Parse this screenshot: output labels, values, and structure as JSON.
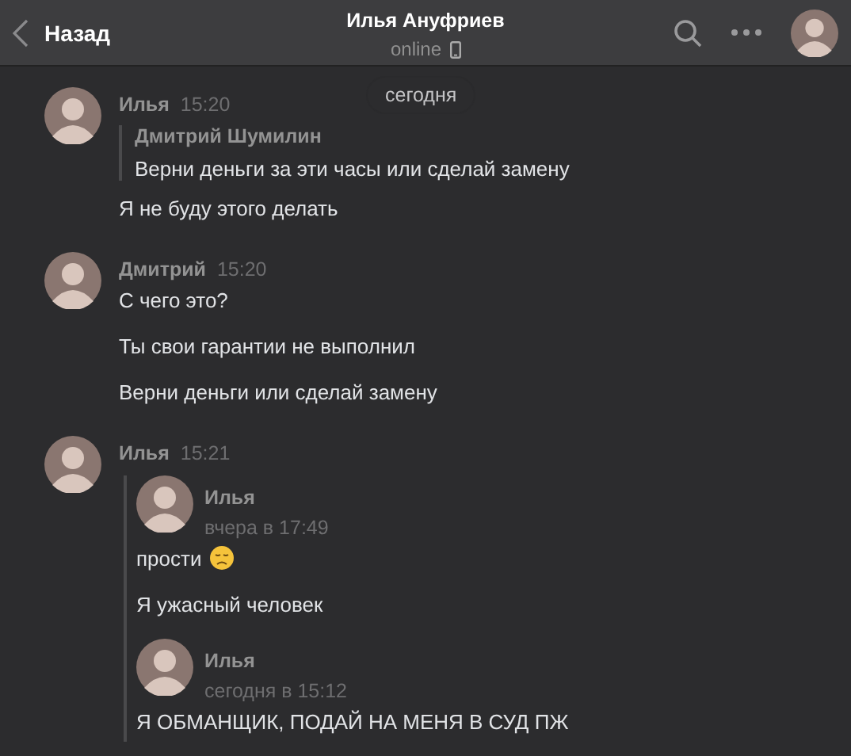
{
  "header": {
    "back_label": "Назад",
    "title": "Илья Ануфриев",
    "status": "online"
  },
  "date_divider": "сегодня",
  "messages": [
    {
      "author": "Илья",
      "time": "15:20",
      "blocks": [
        {
          "kind": "forward",
          "author": "Дмитрий Шумилин",
          "text": "Верни деньги за эти часы или сделай замену"
        },
        {
          "kind": "text",
          "text": "Я не буду этого делать"
        }
      ]
    },
    {
      "author": "Дмитрий",
      "time": "15:20",
      "blocks": [
        {
          "kind": "text",
          "text": "С чего это?"
        },
        {
          "kind": "text",
          "text": "Ты свои гарантии не выполнил"
        },
        {
          "kind": "text",
          "text": "Верни деньги или сделай замену"
        }
      ]
    },
    {
      "author": "Илья",
      "time": "15:21",
      "blocks": [
        {
          "kind": "forward_group",
          "items": [
            {
              "author": "Илья",
              "time": "вчера в 17:49",
              "texts": [
                {
                  "kind": "text_with_emoji",
                  "text": "прости"
                },
                {
                  "kind": "text",
                  "text": "Я ужасный человек"
                }
              ]
            },
            {
              "author": "Илья",
              "time": "сегодня в 15:12",
              "texts": [
                {
                  "kind": "text",
                  "text": "Я ОБМАНЩИК, ПОДАЙ НА МЕНЯ В СУД ПЖ"
                }
              ]
            }
          ]
        }
      ]
    }
  ]
}
